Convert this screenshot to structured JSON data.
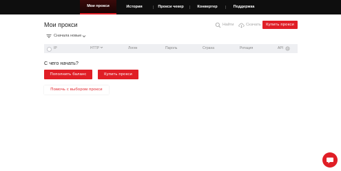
{
  "nav": {
    "items": [
      {
        "label": "Мои прокси",
        "active": true
      },
      {
        "label": "История"
      },
      {
        "label": "Прокси чекер"
      },
      {
        "label": "Конвертер"
      },
      {
        "label": "Поддержка"
      }
    ]
  },
  "header": {
    "title": "Мои прокси",
    "find_label": "Найти",
    "download_label": "Скачать",
    "buy_label": "Купить прокси"
  },
  "sort": {
    "label": "Сначала новые"
  },
  "table": {
    "columns": [
      "IP",
      "HTTP",
      "Логин",
      "Пароль",
      "Страна",
      "Ротация",
      "API"
    ]
  },
  "empty": {
    "title": "С чего начать?",
    "topup_label": "Пополнить баланс",
    "buy_label": "Купить прокси",
    "help_label": "Помочь с выбором прокси"
  },
  "colors": {
    "accent": "#e01e26",
    "nav_bg": "#0e0e0e"
  },
  "icons": [
    "search-icon",
    "cloud-download-icon",
    "sort-icon",
    "chevron-down-icon",
    "settings-icon",
    "chat-icon"
  ]
}
